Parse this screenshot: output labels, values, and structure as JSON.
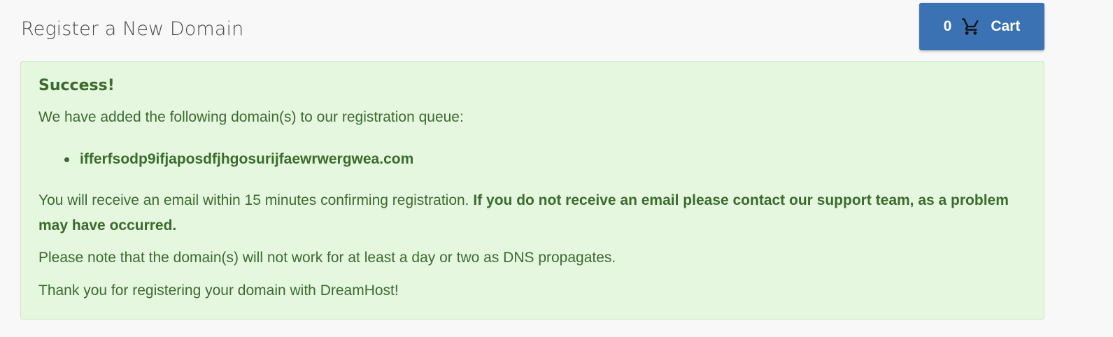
{
  "header": {
    "title": "Register a New Domain"
  },
  "cart": {
    "count": "0",
    "label": "Cart",
    "icon": "cart-icon",
    "color": "#3b72b4"
  },
  "alert": {
    "heading": "Success!",
    "intro": "We have added the following domain(s) to our registration queue:",
    "domains": [
      "ifferfsodp9ifjaposdfjhgosurijfaewrwergwea.com"
    ],
    "confirm_text": "You will receive an email within 15 minutes confirming registration.",
    "confirm_bold": "If you do not receive an email please contact our support team, as a problem may have occurred.",
    "dns_note": "Please note that the domain(s) will not work for at least a day or two as DNS propagates.",
    "thanks": "Thank you for registering your domain with DreamHost!",
    "background": "#e5f7df",
    "text_color": "#3b6b2c"
  }
}
